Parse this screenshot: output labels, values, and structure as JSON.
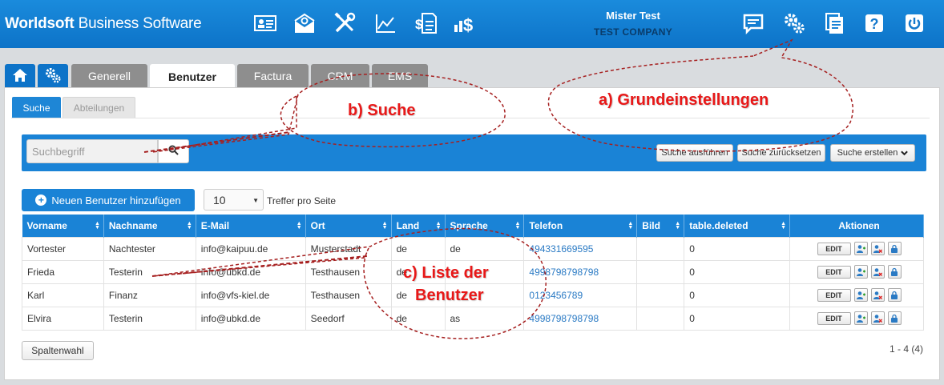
{
  "header": {
    "brand_bold": "Worldsoft",
    "brand_rest": " Business Software",
    "user_name": "Mister Test",
    "company": "TEST COMPANY"
  },
  "tabs": [
    "Generell",
    "Benutzer",
    "Factura",
    "CRM",
    "EMS"
  ],
  "subtabs": [
    "Suche",
    "Abteilungen"
  ],
  "search": {
    "placeholder": "Suchbegriff",
    "run": "Suche ausführen",
    "reset": "Suche zurücksetzen",
    "create": "Suche erstellen"
  },
  "toolbar": {
    "add_label": "Neuen Benutzer hinzufügen",
    "per_page": "10",
    "per_page_label": "Treffer pro Seite"
  },
  "table": {
    "columns": [
      "Vorname",
      "Nachname",
      "E-Mail",
      "Ort",
      "Land",
      "Sprache",
      "Telefon",
      "Bild",
      "table.deleted",
      "Aktionen"
    ],
    "rows": [
      [
        "Vortester",
        "Nachtester",
        "info@kaipuu.de",
        "Musterstadt",
        "de",
        "de",
        "494331669595",
        "",
        "0"
      ],
      [
        "Frieda",
        "Testerin",
        "info@ubkd.de",
        "Testhausen",
        "de",
        "",
        "4998798798798",
        "",
        "0"
      ],
      [
        "Karl",
        "Finanz",
        "info@vfs-kiel.de",
        "Testhausen",
        "de",
        "",
        "0123456789",
        "",
        "0"
      ],
      [
        "Elvira",
        "Testerin",
        "info@ubkd.de",
        "Seedorf",
        "de",
        "as",
        "4998798798798",
        "",
        "0"
      ]
    ],
    "edit_label": "EDIT"
  },
  "footer": {
    "columns_button": "Spaltenwahl",
    "pagination": "1 - 4 (4)"
  },
  "annotations": {
    "a": "a) Grundeinstellungen",
    "b": "b) Suche",
    "c_line1": "c) Liste der",
    "c_line2": "Benutzer"
  },
  "colors": {
    "header_blue": "#0d73c8",
    "accent_blue": "#1a83d6",
    "annotation_red": "#e81818"
  },
  "icons": {
    "header": [
      "contact-card-icon",
      "mail-settings-icon",
      "tools-icon",
      "chart-icon",
      "invoice-icon",
      "finance-icon",
      "chat-icon",
      "settings-icon",
      "documents-icon",
      "help-icon",
      "power-icon"
    ],
    "tabs": [
      "home-icon",
      "settings-icon"
    ],
    "row_actions": [
      "add-user-icon",
      "remove-user-icon",
      "lock-icon"
    ]
  }
}
